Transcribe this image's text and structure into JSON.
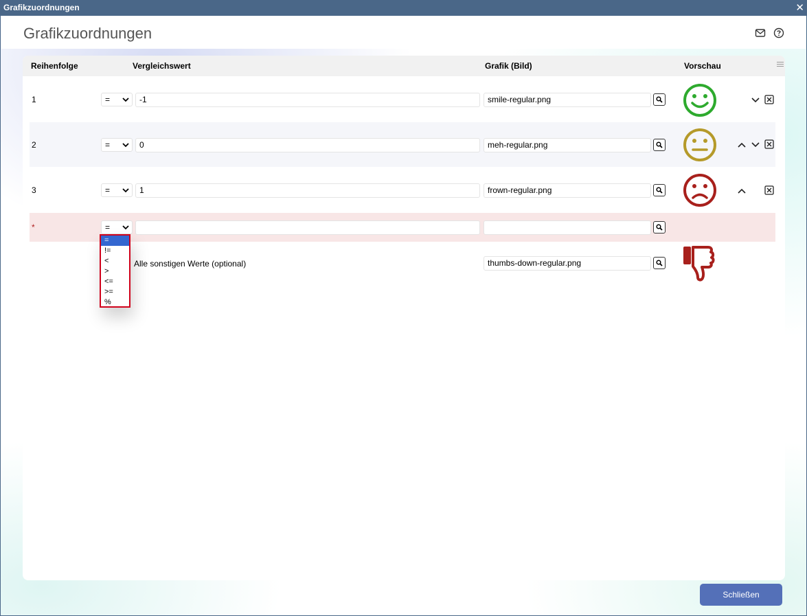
{
  "window": {
    "title": "Grafikzuordnungen",
    "close_glyph": "✕"
  },
  "page": {
    "title": "Grafikzuordnungen"
  },
  "header_icons": [
    "mail-icon",
    "help-icon"
  ],
  "columns": {
    "order": "Reihenfolge",
    "compare": "Vergleichswert",
    "graphic": "Grafik (Bild)",
    "preview": "Vorschau"
  },
  "rows": [
    {
      "order": "1",
      "operator": "=",
      "value": "-1",
      "graphic": "smile-regular.png",
      "preview_icon": "smile-icon",
      "preview_color": "#2eaa2e"
    },
    {
      "order": "2",
      "operator": "=",
      "value": "0",
      "graphic": "meh-regular.png",
      "preview_icon": "meh-icon",
      "preview_color": "#b59a2a"
    },
    {
      "order": "3",
      "operator": "=",
      "value": "1",
      "graphic": "frown-regular.png",
      "preview_icon": "frown-icon",
      "preview_color": "#a8201c"
    }
  ],
  "new_row": {
    "order": "*",
    "operator": "=",
    "value": "",
    "graphic": ""
  },
  "operator_options": [
    "=",
    "!=",
    "<",
    ">",
    "<=",
    ">=",
    "%"
  ],
  "operator_selected": "=",
  "default_row": {
    "label": "Alle sonstigen Werte (optional)",
    "graphic": "thumbs-down-regular.png",
    "preview_icon": "thumbs-down-icon",
    "preview_color": "#a8201c"
  },
  "buttons": {
    "close": "Schließen"
  },
  "colors": {
    "titlebar": "#4a6788",
    "accent": "#5470b8",
    "highlight": "#d0021b",
    "new_row_bg": "#f8e6e6"
  }
}
